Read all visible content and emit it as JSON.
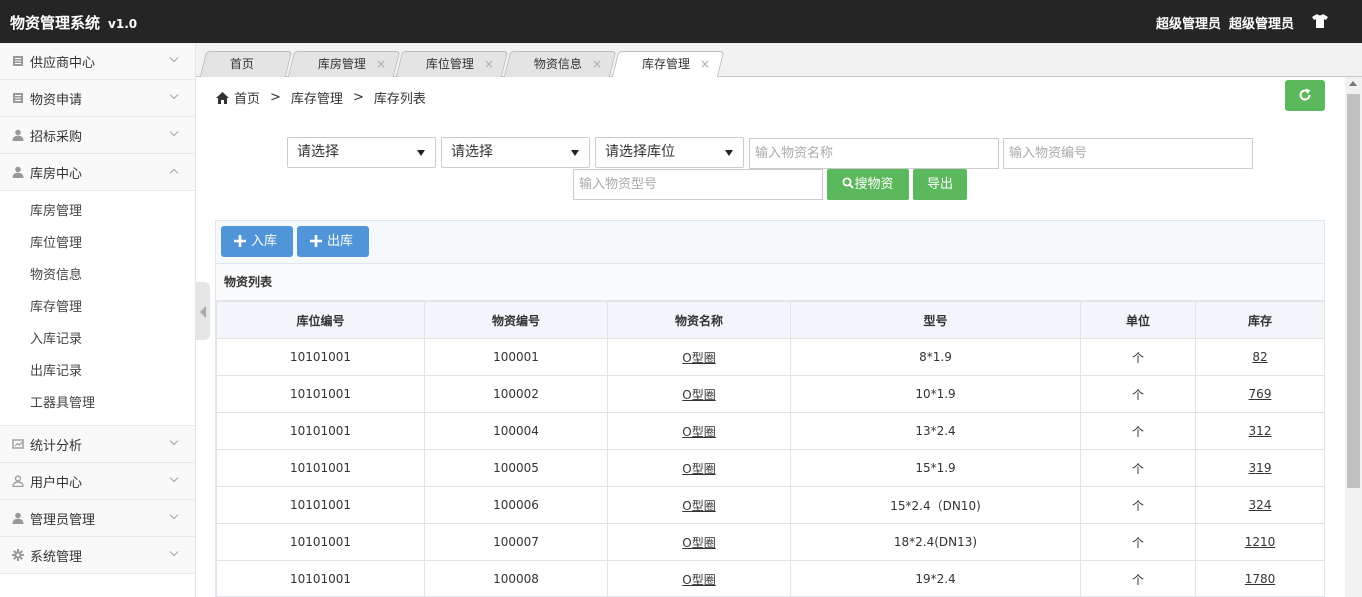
{
  "header": {
    "title": "物资管理系统",
    "version": "v1.0",
    "user_role": "超级管理员",
    "user_name": "超级管理员"
  },
  "sidebar": {
    "items_before": [
      {
        "label": "供应商中心",
        "icon": "book-icon"
      },
      {
        "label": "物资申请",
        "icon": "book-icon"
      },
      {
        "label": "招标采购",
        "icon": "user-icon"
      }
    ],
    "expanded": {
      "label": "库房中心",
      "icon": "user-icon"
    },
    "sub_items": [
      "库房管理",
      "库位管理",
      "物资信息",
      "库存管理",
      "入库记录",
      "出库记录",
      "工器具管理"
    ],
    "items_after": [
      {
        "label": "统计分析",
        "icon": "chart-icon"
      },
      {
        "label": "用户中心",
        "icon": "user-outline-icon"
      },
      {
        "label": "管理员管理",
        "icon": "user-icon"
      },
      {
        "label": "系统管理",
        "icon": "gear-icon"
      }
    ]
  },
  "tabs": [
    {
      "label": "首页",
      "closable": false
    },
    {
      "label": "库房管理",
      "closable": true
    },
    {
      "label": "库位管理",
      "closable": true
    },
    {
      "label": "物资信息",
      "closable": true
    },
    {
      "label": "库存管理",
      "closable": true,
      "active": true
    }
  ],
  "tab_close_glyph": "×",
  "breadcrumb": {
    "items": [
      "首页",
      "库存管理",
      "库存列表"
    ],
    "separator": ">"
  },
  "filters": {
    "select1": "请选择",
    "select2": "请选择",
    "select3": "请选择库位",
    "name_placeholder": "输入物资名称",
    "code_placeholder": "输入物资编号",
    "model_placeholder": "输入物资型号",
    "search_label": "搜物资",
    "export_label": "导出"
  },
  "toolbar": {
    "in_label": "入库",
    "out_label": "出库"
  },
  "panel_title": "物资列表",
  "table": {
    "columns": [
      "库位编号",
      "物资编号",
      "物资名称",
      "型号",
      "单位",
      "库存"
    ],
    "rows": [
      [
        "10101001",
        "100001",
        "O型圈",
        "8*1.9",
        "个",
        "82"
      ],
      [
        "10101001",
        "100002",
        "O型圈",
        "10*1.9",
        "个",
        "769"
      ],
      [
        "10101001",
        "100004",
        "O型圈",
        "13*2.4",
        "个",
        "312"
      ],
      [
        "10101001",
        "100005",
        "O型圈",
        "15*1.9",
        "个",
        "319"
      ],
      [
        "10101001",
        "100006",
        "O型圈",
        "15*2.4（DN10)",
        "个",
        "324"
      ],
      [
        "10101001",
        "100007",
        "O型圈",
        "18*2.4(DN13)",
        "个",
        "1210"
      ],
      [
        "10101001",
        "100008",
        "O型圈",
        "19*2.4",
        "个",
        "1780"
      ]
    ]
  },
  "colors": {
    "topbar": "#252525",
    "green": "#5cb85c",
    "blue": "#4f95d8"
  }
}
